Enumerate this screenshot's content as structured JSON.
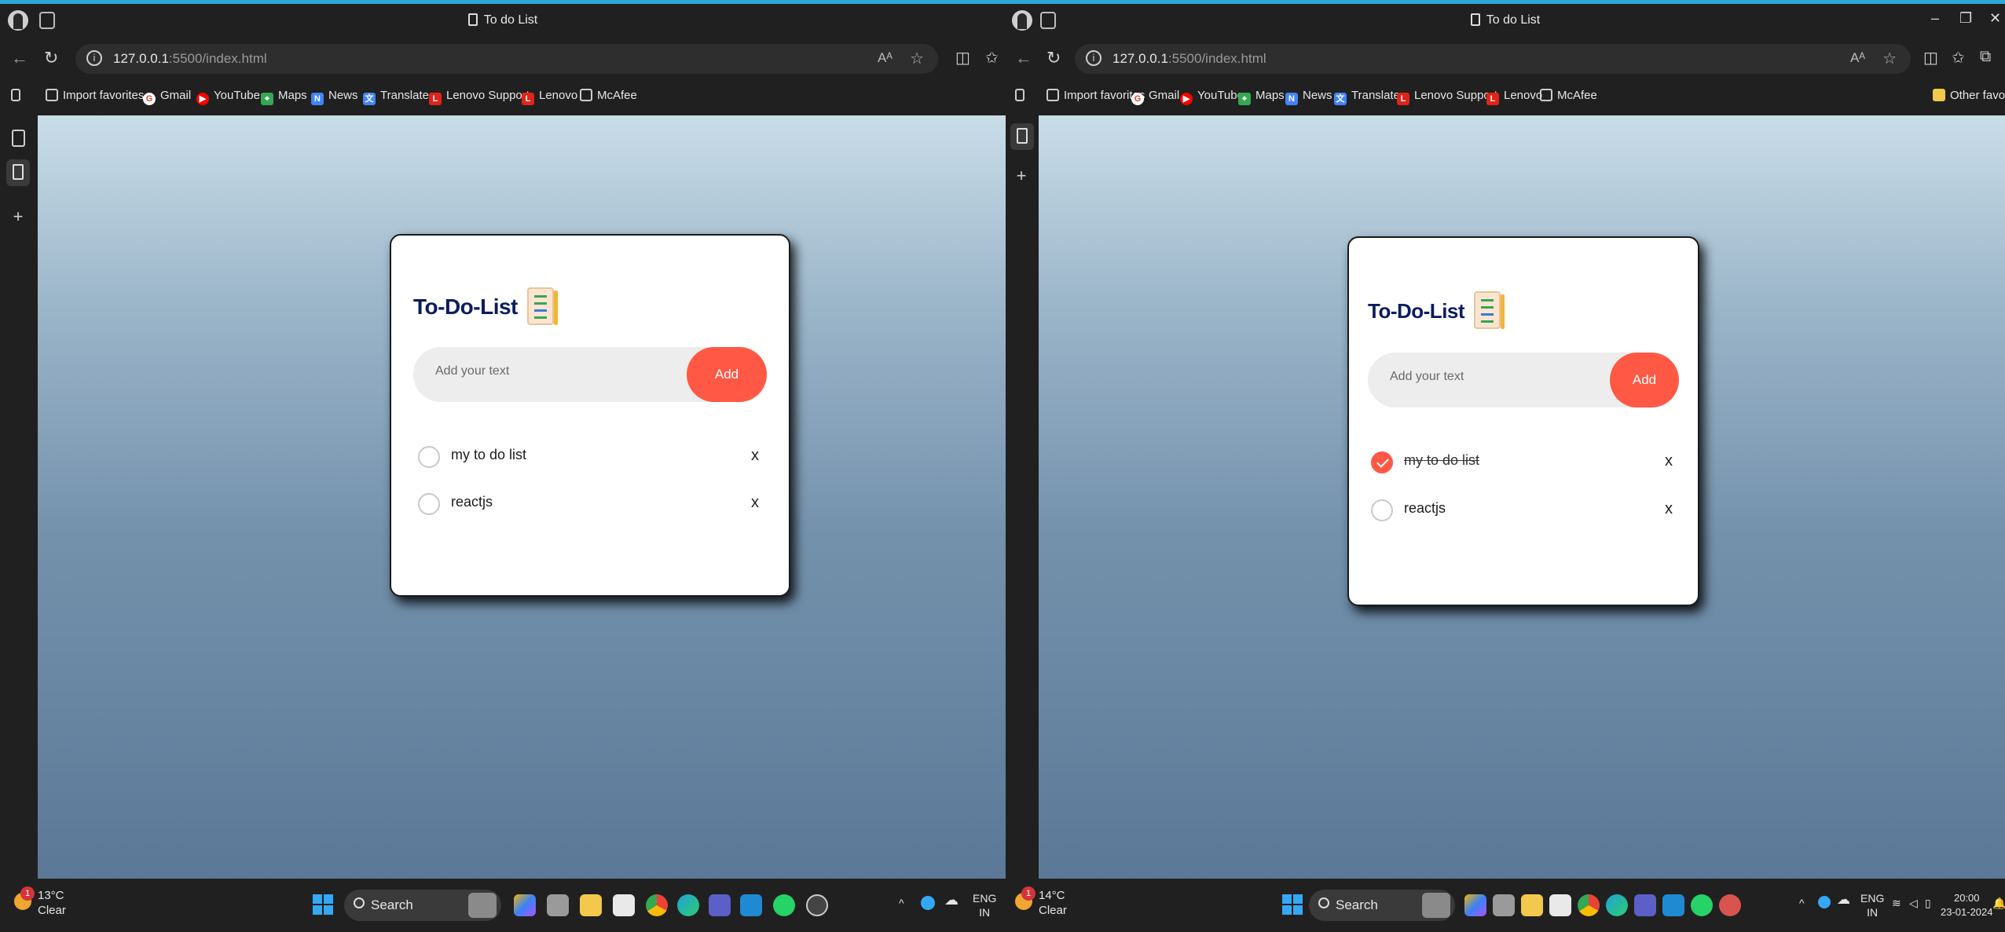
{
  "left_window": {
    "tab_title": "To do List",
    "url_host": "127.0.0.1",
    "url_path": ":5500/index.html",
    "bookmarks": [
      "Import favorites",
      "Gmail",
      "YouTube",
      "Maps",
      "News",
      "Translate",
      "Lenovo Support",
      "Lenovo",
      "McAfee"
    ],
    "app": {
      "title": "To-Do-List",
      "input_placeholder": "Add your text",
      "add_label": "Add",
      "items": [
        {
          "text": "my to do list",
          "checked": false,
          "delete_label": "x"
        },
        {
          "text": "reactjs",
          "checked": false,
          "delete_label": "x"
        }
      ]
    },
    "weather": {
      "temp": "13°C",
      "condition": "Clear",
      "badge": "1"
    },
    "taskbar": {
      "search_label": "Search",
      "lang_line1": "ENG",
      "lang_line2": "IN"
    }
  },
  "right_window": {
    "tab_title": "To do List",
    "url_host": "127.0.0.1",
    "url_path": ":5500/index.html",
    "bookmarks": [
      "Import favorites",
      "Gmail",
      "YouTube",
      "Maps",
      "News",
      "Translate",
      "Lenovo Support",
      "Lenovo",
      "McAfee"
    ],
    "other_favorites": "Other favorites",
    "app": {
      "title": "To-Do-List",
      "input_placeholder": "Add your text",
      "add_label": "Add",
      "items": [
        {
          "text": "my to do list",
          "checked": true,
          "delete_label": "x"
        },
        {
          "text": "reactjs",
          "checked": false,
          "delete_label": "x"
        }
      ]
    },
    "weather": {
      "temp": "14°C",
      "condition": "Clear",
      "badge": "1"
    },
    "taskbar": {
      "search_label": "Search",
      "lang_line1": "ENG",
      "lang_line2": "IN",
      "time": "20:00",
      "date": "23-01-2024"
    }
  },
  "colors": {
    "accent": "#ff5945",
    "title": "#0b1d5e",
    "bg_top": "#c9dde8",
    "bg_bottom": "#5b7997"
  }
}
